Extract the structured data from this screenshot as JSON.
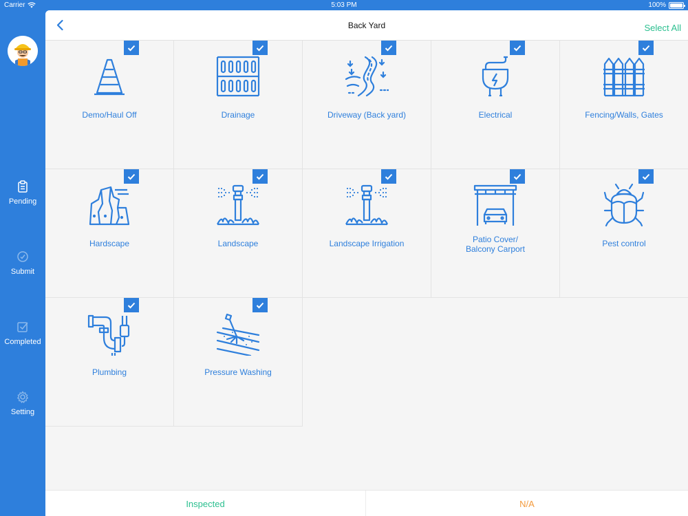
{
  "status_bar": {
    "carrier": "Carrier",
    "time": "5:03 PM",
    "battery": "100%",
    "battery_level": 1.0
  },
  "sidebar": {
    "items": [
      {
        "label": "Pending",
        "icon": "clipboard-icon"
      },
      {
        "label": "Submit",
        "icon": "submit-icon"
      },
      {
        "label": "Completed",
        "icon": "checkbox-icon"
      },
      {
        "label": "Setting",
        "icon": "gear-icon"
      }
    ]
  },
  "header": {
    "title": "Back Yard",
    "select_all": "Select All"
  },
  "tiles": [
    {
      "label": "Demo/Haul Off",
      "icon": "traffic-cone-icon",
      "checked": true
    },
    {
      "label": "Drainage",
      "icon": "drainage-grate-icon",
      "checked": true
    },
    {
      "label": "Driveway (Back yard)",
      "icon": "driveway-road-icon",
      "checked": true
    },
    {
      "label": "Electrical",
      "icon": "electrical-plug-icon",
      "checked": true
    },
    {
      "label": "Fencing/Walls, Gates",
      "icon": "fence-icon",
      "checked": true
    },
    {
      "label": "Hardscape",
      "icon": "rocks-icon",
      "checked": true
    },
    {
      "label": "Landscape",
      "icon": "sprinkler-icon",
      "checked": true
    },
    {
      "label": "Landscape Irrigation",
      "icon": "irrigation-sprinkler-icon",
      "checked": true
    },
    {
      "label": "Patio Cover/\nBalcony Carport",
      "icon": "carport-icon",
      "checked": true
    },
    {
      "label": "Pest control",
      "icon": "bug-icon",
      "checked": true
    },
    {
      "label": "Plumbing",
      "icon": "pipe-icon",
      "checked": true
    },
    {
      "label": "Pressure Washing",
      "icon": "pressure-washer-icon",
      "checked": true
    }
  ],
  "footer": {
    "inspected": "Inspected",
    "na": "N/A"
  },
  "colors": {
    "primary": "#2e7fdc",
    "green": "#2bbf8f",
    "orange": "#f39a3c",
    "background": "#f5f5f5"
  }
}
